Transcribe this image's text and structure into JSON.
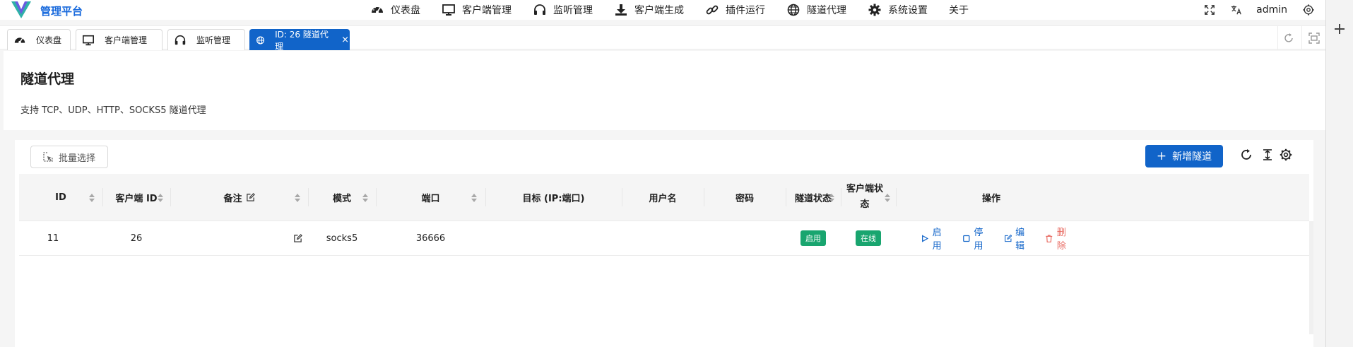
{
  "brand": {
    "name": "管理平台",
    "logo_icon": "v-logo-icon",
    "color": "#1668dc"
  },
  "nav": {
    "items": [
      {
        "label": "仪表盘",
        "icon": "dashboard-icon"
      },
      {
        "label": "客户端管理",
        "icon": "monitor-icon"
      },
      {
        "label": "监听管理",
        "icon": "headphones-icon"
      },
      {
        "label": "客户端生成",
        "icon": "download-icon"
      },
      {
        "label": "插件运行",
        "icon": "link-icon"
      },
      {
        "label": "隧道代理",
        "icon": "globe-icon"
      },
      {
        "label": "系统设置",
        "icon": "gear-icon"
      },
      {
        "label": "关于",
        "icon": ""
      }
    ]
  },
  "header_right": {
    "fullscreen_icon": "fullscreen-icon",
    "language_icon": "language-icon",
    "user": "admin",
    "settings_icon": "settings-icon"
  },
  "tabs": [
    {
      "label": "仪表盘",
      "icon": "dashboard-icon",
      "active": false
    },
    {
      "label": "客户端管理",
      "icon": "monitor-icon",
      "active": false
    },
    {
      "label": "监听管理",
      "icon": "headphones-icon",
      "active": false
    },
    {
      "label": "ID: 26 隧道代理",
      "icon": "globe-icon",
      "active": true,
      "close": "×"
    }
  ],
  "page": {
    "title": "隧道代理",
    "description": "支持 TCP、UDP、HTTP、SOCKS5 隧道代理"
  },
  "toolbar": {
    "batch_select": "批量选择",
    "add_tunnel": "新增隧道",
    "add_icon": "+"
  },
  "table": {
    "columns": {
      "id": "ID",
      "client_id": "客户端 ID",
      "remark": "备注",
      "mode": "模式",
      "port": "端口",
      "target": "目标 (IP:端口)",
      "username": "用户名",
      "password": "密码",
      "tunnel_status": "隧道状态",
      "client_status_1": "客户端状",
      "client_status_2": "态",
      "actions": "操作"
    },
    "rows": [
      {
        "id": "11",
        "client_id": "26",
        "remark": "",
        "mode": "socks5",
        "port": "36666",
        "target": "",
        "username": "",
        "password": "",
        "tunnel_status": "启用",
        "client_status": "在线",
        "actions": {
          "enable": "启用",
          "disable": "停用",
          "edit": "编辑",
          "delete": "删除"
        }
      }
    ]
  },
  "colors": {
    "primary": "#1164c9",
    "success": "#19a56f",
    "danger": "#e8685f"
  }
}
